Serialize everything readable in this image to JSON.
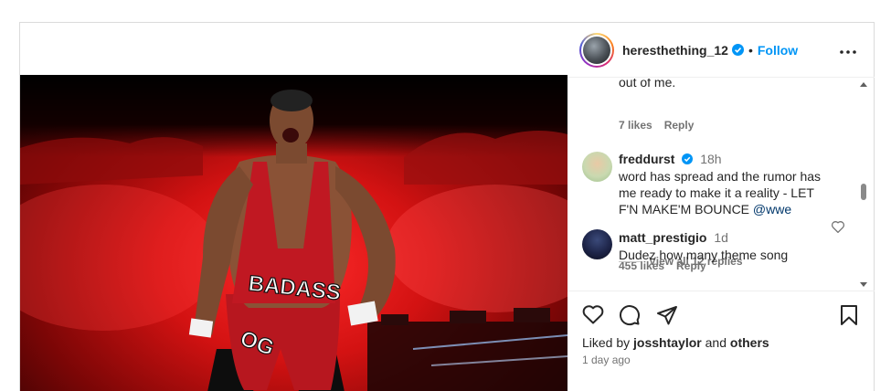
{
  "post": {
    "username": "heresthething_12",
    "follow_label": "Follow",
    "separator": "•"
  },
  "comments": [
    {
      "text_partial": "out of me.",
      "likes": "7 likes",
      "reply_label": "Reply"
    },
    {
      "username": "freddurst",
      "time": "18h",
      "text": "word has spread and the rumor has me ready to make it a reality - LET F'N MAKE'M BOUNCE ",
      "mention": "@wwe",
      "likes": "455 likes",
      "reply_label": "Reply",
      "view_replies": "View all 12 replies"
    },
    {
      "username": "matt_prestigio",
      "time": "1d",
      "text": "Dudez how many theme song"
    }
  ],
  "photo": {
    "trunks_text": "BADASS",
    "belt_text": "OG"
  },
  "footer": {
    "liked_prefix": "Liked by ",
    "liked_user": "josshtaylor",
    "liked_middle": " and ",
    "liked_others": "others",
    "timestamp": "1 day ago"
  },
  "icons": {
    "verified": "verified-badge-icon",
    "more": "more-options-icon",
    "like": "heart-icon",
    "comment": "comment-icon",
    "share": "share-icon",
    "save": "bookmark-icon"
  },
  "colors": {
    "follow": "#0095f6",
    "verified": "#0095f6",
    "mention": "#00376b",
    "muted": "#737373"
  }
}
